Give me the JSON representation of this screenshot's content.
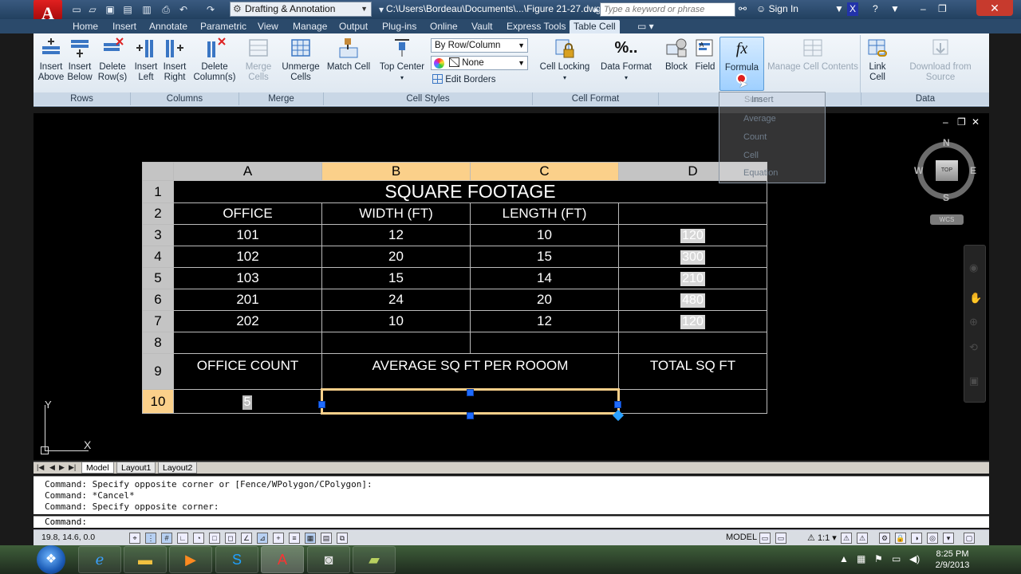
{
  "app": {
    "logo_letter": "A",
    "workspace": "Drafting & Annotation",
    "file_path": "C:\\Users\\Bordeau\\Documents\\...\\Figure 21-27.dwg",
    "search_placeholder": "Type a keyword or phrase",
    "sign_in": "Sign In"
  },
  "tabs": [
    "Home",
    "Insert",
    "Annotate",
    "Parametric",
    "View",
    "Manage",
    "Output",
    "Plug-ins",
    "Online",
    "Vault",
    "Express Tools",
    "Table Cell"
  ],
  "ribbon": {
    "rows": {
      "insert_above": "Insert Above",
      "insert_below": "Insert Below",
      "delete_rows": "Delete Row(s)",
      "label": "Rows"
    },
    "columns": {
      "insert_left": "Insert Left",
      "insert_right": "Insert Right",
      "delete_columns": "Delete Column(s)",
      "label": "Columns"
    },
    "merge": {
      "merge_cells": "Merge Cells",
      "unmerge_cells": "Unmerge Cells",
      "label": "Merge"
    },
    "cell_styles": {
      "match_cell": "Match Cell",
      "top_center": "Top Center",
      "by_row_column": "By Row/Column",
      "none": "None",
      "edit_borders": "Edit Borders",
      "label": "Cell Styles"
    },
    "cell_format": {
      "cell_locking": "Cell Locking",
      "data_format": "Data Format",
      "label": "Cell Format"
    },
    "insert": {
      "block": "Block",
      "field": "Field",
      "formula": "Formula",
      "manage_cell_contents": "Manage Cell Contents"
    },
    "data": {
      "link_cell": "Link Cell",
      "download_from_source": "Download from Source",
      "label": "Data"
    }
  },
  "formula_menu": [
    "Sum",
    "Insert",
    "Average",
    "Count",
    "Cell",
    "Equation"
  ],
  "table": {
    "column_headers": [
      "A",
      "B",
      "C",
      "D"
    ],
    "title": "SQUARE FOOTAGE",
    "headers": [
      "OFFICE",
      "WIDTH (FT)",
      "LENGTH (FT)",
      ""
    ],
    "rows": [
      {
        "office": "101",
        "width": "12",
        "length": "10",
        "sqft": "120"
      },
      {
        "office": "102",
        "width": "20",
        "length": "15",
        "sqft": "300"
      },
      {
        "office": "103",
        "width": "15",
        "length": "14",
        "sqft": "210"
      },
      {
        "office": "201",
        "width": "24",
        "length": "20",
        "sqft": "480"
      },
      {
        "office": "202",
        "width": "10",
        "length": "12",
        "sqft": "120"
      }
    ],
    "summary_labels": [
      "OFFICE COUNT",
      "AVERAGE SQ FT PER ROOOM",
      "TOTAL SQ FT"
    ],
    "office_count_value": "5",
    "row_numbers": [
      "1",
      "2",
      "3",
      "4",
      "5",
      "6",
      "7",
      "8",
      "9",
      "10"
    ]
  },
  "viewcube": {
    "n": "N",
    "s": "S",
    "e": "E",
    "w": "W",
    "top": "TOP",
    "wcs": "WCS"
  },
  "ucs": {
    "x": "X",
    "y": "Y"
  },
  "layout_tabs": [
    "Model",
    "Layout1",
    "Layout2"
  ],
  "command_history": [
    "Command: Specify opposite corner or [Fence/WPolygon/CPolygon]:",
    "Command: *Cancel*",
    "Command: Specify opposite corner:"
  ],
  "command_prompt": "Command:",
  "status": {
    "coords": "19.8, 14.6, 0.0",
    "model": "MODEL",
    "scale": "1:1"
  },
  "clock": {
    "time": "8:25 PM",
    "date": "2/9/2013"
  }
}
